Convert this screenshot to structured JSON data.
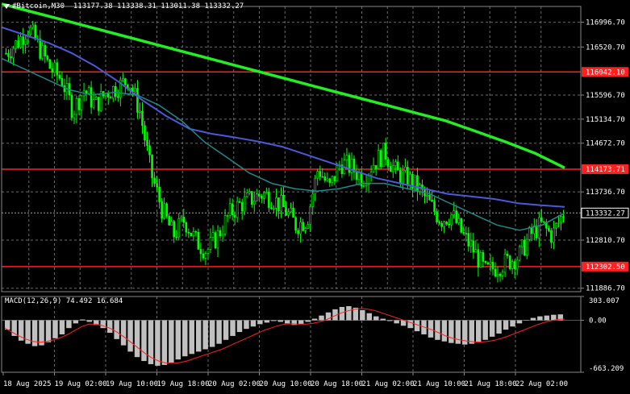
{
  "header": {
    "symbol": "#Bitcoin,M30",
    "ohlc": "113177.38 113338.31 113011.38 113332.27"
  },
  "macd_header": {
    "label": "MACD(12,26,9)",
    "values": "74.492 16.684"
  },
  "colors": {
    "background": "#000000",
    "bull_candle": "#00ff00",
    "bear_candle": "#00ff00",
    "ma_fast": "#1e8a8a",
    "ma_mid": "#4a5ad8",
    "ma_slow": "#22ee22",
    "level_line": "#ff2020",
    "price_tag": "#ff2020",
    "macd_hist": "#c0c0c0",
    "macd_signal": "#ff2020",
    "grid": "#6a6a6a"
  },
  "chart_data": {
    "type": "candlestick",
    "price_axis": {
      "ticks": [
        "116996.70",
        "116520.70",
        "115596.70",
        "115134.70",
        "114672.70",
        "113736.70",
        "112810.70",
        "111886.70"
      ],
      "tick_values": [
        116996.7,
        116520.7,
        115596.7,
        115134.7,
        114672.7,
        113736.7,
        112810.7,
        111886.7
      ],
      "range": [
        111820,
        117300
      ]
    },
    "time_axis": {
      "ticks": [
        "18 Aug 2025",
        "19 Aug 02:00",
        "19 Aug 10:00",
        "19 Aug 18:00",
        "20 Aug 02:00",
        "20 Aug 10:00",
        "20 Aug 18:00",
        "21 Aug 02:00",
        "21 Aug 10:00",
        "21 Aug 18:00",
        "22 Aug 02:00"
      ]
    },
    "levels": [
      {
        "label": "116042.10",
        "value": 116042.1
      },
      {
        "label": "114173.71",
        "value": 114173.71
      },
      {
        "label": "112302.50",
        "value": 112302.5
      }
    ],
    "current_price": {
      "label": "113332.27",
      "value": 113332.27
    },
    "close_path": [
      116400,
      116600,
      116900,
      116500,
      116100,
      115900,
      115300,
      115700,
      115400,
      115650,
      115750,
      115900,
      115300,
      114100,
      113400,
      112900,
      113200,
      112800,
      112600,
      112900,
      113300,
      113500,
      113600,
      113700,
      113600,
      113400,
      113100,
      113200,
      114200,
      113800,
      114300,
      114200,
      114000,
      114300,
      114500,
      114100,
      114000,
      113800,
      113500,
      113200,
      113300,
      112900,
      112600,
      112200,
      112300,
      112400,
      112500,
      112900,
      113100,
      112900,
      113332
    ],
    "ma_fast": [
      116300,
      116100,
      115900,
      115700,
      115600,
      115650,
      115600,
      115400,
      115100,
      114700,
      114400,
      114100,
      113900,
      113800,
      113750,
      113800,
      113900,
      113900,
      113800,
      113700,
      113500,
      113300,
      113100,
      113000,
      113100,
      113332
    ],
    "ma_mid": [
      116900,
      116750,
      116600,
      116400,
      116150,
      115850,
      115500,
      115200,
      114950,
      114850,
      114780,
      114700,
      114600,
      114450,
      114300,
      114150,
      114000,
      113900,
      113800,
      113700,
      113650,
      113600,
      113520,
      113480,
      113450
    ],
    "ma_slow": [
      117350,
      117200,
      117050,
      116900,
      116750,
      116600,
      116450,
      116300,
      116150,
      116000,
      115850,
      115700,
      115550,
      115400,
      115250,
      115100,
      114900,
      114700,
      114480,
      114200
    ],
    "macd": {
      "axis_ticks": [
        "303.007",
        "0.00",
        "-663.209"
      ],
      "range": [
        -663.209,
        303.007
      ],
      "histogram": [
        -120,
        -200,
        -260,
        -300,
        -330,
        -320,
        -280,
        -230,
        -180,
        -100,
        -40,
        10,
        -20,
        -60,
        -100,
        -160,
        -240,
        -320,
        -400,
        -470,
        -520,
        -560,
        -580,
        -570,
        -540,
        -500,
        -460,
        -430,
        -400,
        -370,
        -340,
        -300,
        -250,
        -200,
        -150,
        -110,
        -80,
        -50,
        -30,
        -10,
        -20,
        -40,
        -60,
        -50,
        -20,
        20,
        60,
        100,
        140,
        170,
        180,
        160,
        130,
        90,
        50,
        20,
        -10,
        -40,
        -70,
        -100,
        -140,
        -180,
        -220,
        -250,
        -270,
        -290,
        -300,
        -310,
        -300,
        -280,
        -250,
        -210,
        -170,
        -120,
        -80,
        -40,
        0,
        30,
        50,
        60,
        70,
        75
      ],
      "signal": [
        -100,
        -150,
        -200,
        -240,
        -270,
        -280,
        -270,
        -250,
        -220,
        -180,
        -130,
        -80,
        -50,
        -50,
        -70,
        -100,
        -150,
        -210,
        -280,
        -350,
        -420,
        -480,
        -520,
        -545,
        -550,
        -540,
        -520,
        -490,
        -460,
        -430,
        -400,
        -370,
        -330,
        -290,
        -250,
        -210,
        -170,
        -130,
        -100,
        -70,
        -50,
        -45,
        -50,
        -50,
        -40,
        -20,
        10,
        50,
        90,
        120,
        140,
        150,
        140,
        120,
        90,
        60,
        30,
        0,
        -30,
        -60,
        -90,
        -120,
        -160,
        -200,
        -230,
        -250,
        -265,
        -275,
        -278,
        -270,
        -255,
        -230,
        -200,
        -165,
        -130,
        -95,
        -60,
        -30,
        -5,
        10,
        16
      ]
    }
  }
}
